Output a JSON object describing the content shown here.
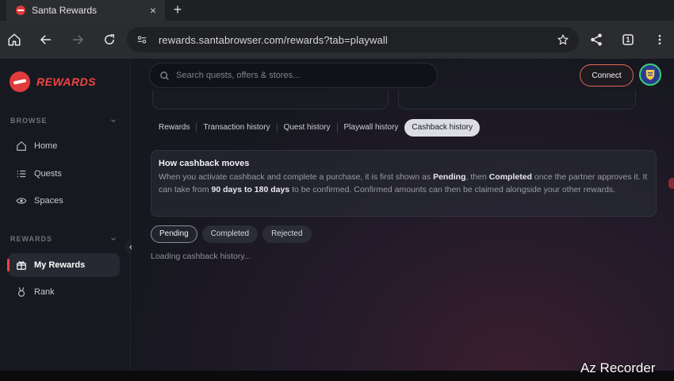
{
  "browser": {
    "tab_title": "Santa Rewards",
    "tab_close": "×",
    "new_tab": "+",
    "url": "rewards.santabrowser.com/rewards?tab=playwall",
    "tab_count": "1"
  },
  "sidebar": {
    "logo_text": "REWARDS",
    "sections": [
      {
        "label": "BROWSE",
        "items": [
          {
            "label": "Home",
            "icon": "home-icon"
          },
          {
            "label": "Quests",
            "icon": "list-icon"
          },
          {
            "label": "Spaces",
            "icon": "eye-icon"
          }
        ]
      },
      {
        "label": "REWARDS",
        "items": [
          {
            "label": "My Rewards",
            "icon": "gift-icon",
            "active": true
          },
          {
            "label": "Rank",
            "icon": "medal-icon"
          }
        ]
      }
    ]
  },
  "header": {
    "search_placeholder": "Search quests, offers & stores...",
    "connect_label": "Connect"
  },
  "tabs": [
    {
      "label": "Rewards"
    },
    {
      "label": "Transaction history"
    },
    {
      "label": "Quest history"
    },
    {
      "label": "Playwall history"
    },
    {
      "label": "Cashback history",
      "active": true
    }
  ],
  "info": {
    "title": "How cashback moves",
    "text_1": "When you activate cashback and complete a purchase, it is first shown as ",
    "bold_1": "Pending",
    "text_2": ", then ",
    "bold_2": "Completed",
    "text_3": " once the partner approves it. It can take from ",
    "bold_3": "90 days to 180 days",
    "text_4": " to be confirmed. Confirmed amounts can then be claimed alongside your other rewards."
  },
  "filters": [
    {
      "label": "Pending",
      "active": true
    },
    {
      "label": "Completed"
    },
    {
      "label": "Rejected"
    }
  ],
  "status": {
    "loading": "Loading cashback history..."
  },
  "watermark": "Az Recorder",
  "colors": {
    "accent": "#ef4444",
    "connect_border": "#e06a55",
    "avatar_ring": "#3ccf7a"
  }
}
